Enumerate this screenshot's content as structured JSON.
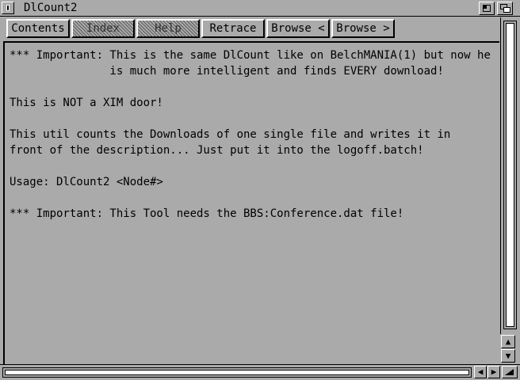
{
  "window": {
    "title": "DlCount2"
  },
  "toolbar": {
    "contents": "Contents",
    "index": "Index",
    "help": "Help",
    "retrace": "Retrace",
    "browse_prev": "Browse <",
    "browse_next": "Browse >"
  },
  "content": {
    "lines": [
      "*** Important: This is the same DlCount like on BelchMANIA(1) but now he",
      "               is much more intelligent and finds EVERY download!",
      "",
      "This is NOT a XIM door!",
      "",
      "This util counts the Downloads of one single file and writes it in",
      "front of the description... Just put it into the logoff.batch!",
      "",
      "Usage: DlCount2 <Node#>",
      "",
      "*** Important: This Tool needs the BBS:Conference.dat file!"
    ]
  },
  "scroll": {
    "up_glyph": "▲",
    "down_glyph": "▼",
    "left_glyph": "◀",
    "right_glyph": "▶"
  },
  "icons": [
    "close-icon",
    "zoom-icon",
    "depth-icon",
    "resize-icon"
  ],
  "colors": {
    "background": "#aaaaaa",
    "highlight": "#ffffff",
    "shadow": "#000000"
  }
}
